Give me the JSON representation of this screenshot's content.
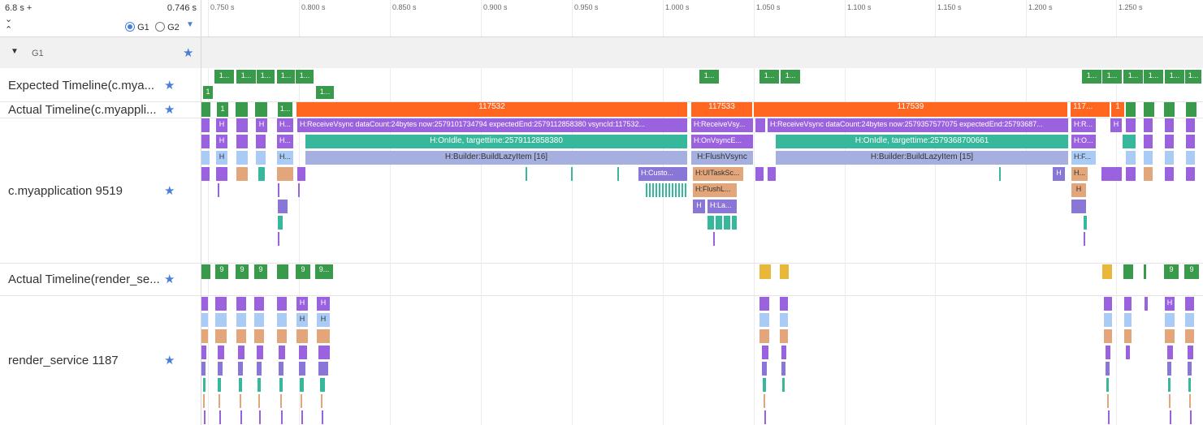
{
  "header": {
    "range_start": "6.8 s +",
    "range_end": "0.746 s",
    "expand_icon": "chevron-down-icon",
    "collapse_icon": "chevron-up-icon",
    "groups": [
      {
        "label": "G1",
        "selected": true
      },
      {
        "label": "G2",
        "selected": false
      }
    ],
    "filter_icon": "triangle-down-icon"
  },
  "ticks": [
    "0.750 s",
    "0.800 s",
    "0.850 s",
    "0.900 s",
    "0.950 s",
    "1.000 s",
    "1.050 s",
    "1.100 s",
    "1.150 s",
    "1.200 s",
    "1.250 s"
  ],
  "group": {
    "label": "G1"
  },
  "tracks": {
    "expected_app": "Expected Timeline(c.mya...",
    "actual_app": "Actual Timeline(c.myappli...",
    "process_app": "c.myapplication 9519",
    "actual_render": "Actual Timeline(render_se...",
    "process_render": "render_service 1187"
  },
  "labels": {
    "one": "1",
    "one_dots": "1...",
    "nine": "9",
    "nine_dots": "9...",
    "h": "H",
    "h_dots": "H...",
    "f117532": "117532",
    "f117533": "117533",
    "f117539": "117539",
    "f117_dots": "117...",
    "receive_vsync_1": "H:ReceiveVsync dataCount:24bytes now:2579101734794 expectedEnd:2579112858380 vsyncId:117532...",
    "receive_vsync_2": "H:ReceiveVsy...",
    "receive_vsync_3": "H:ReceiveVsync dataCount:24bytes now:2579357577075 expectedEnd:25793687...",
    "on_idle_1": "H:OnIdle, targettime:2579112858380",
    "on_vsync": "H:OnVsyncE...",
    "on_idle_2": "H:OnIdle, targettime:2579368700661",
    "builder_16": "H:Builder:BuildLazyItem [16]",
    "flush_vsync": "H:FlushVsync",
    "builder_15": "H:Builder:BuildLazyItem [15]",
    "custo": "H:Custo...",
    "ui_task": "H:UITaskSc...",
    "flush_l": "H:FlushL...",
    "h_la": "H:La...",
    "h_r": "H:R...",
    "h_o": "H:O...",
    "h_f": "H:F..."
  },
  "colors": {
    "green": "#3a9a4c",
    "orange": "#ff661f",
    "purple": "#9b62e0",
    "teal": "#37b89c",
    "lavender": "#a5b0e0",
    "star": "#4a7fd8"
  }
}
